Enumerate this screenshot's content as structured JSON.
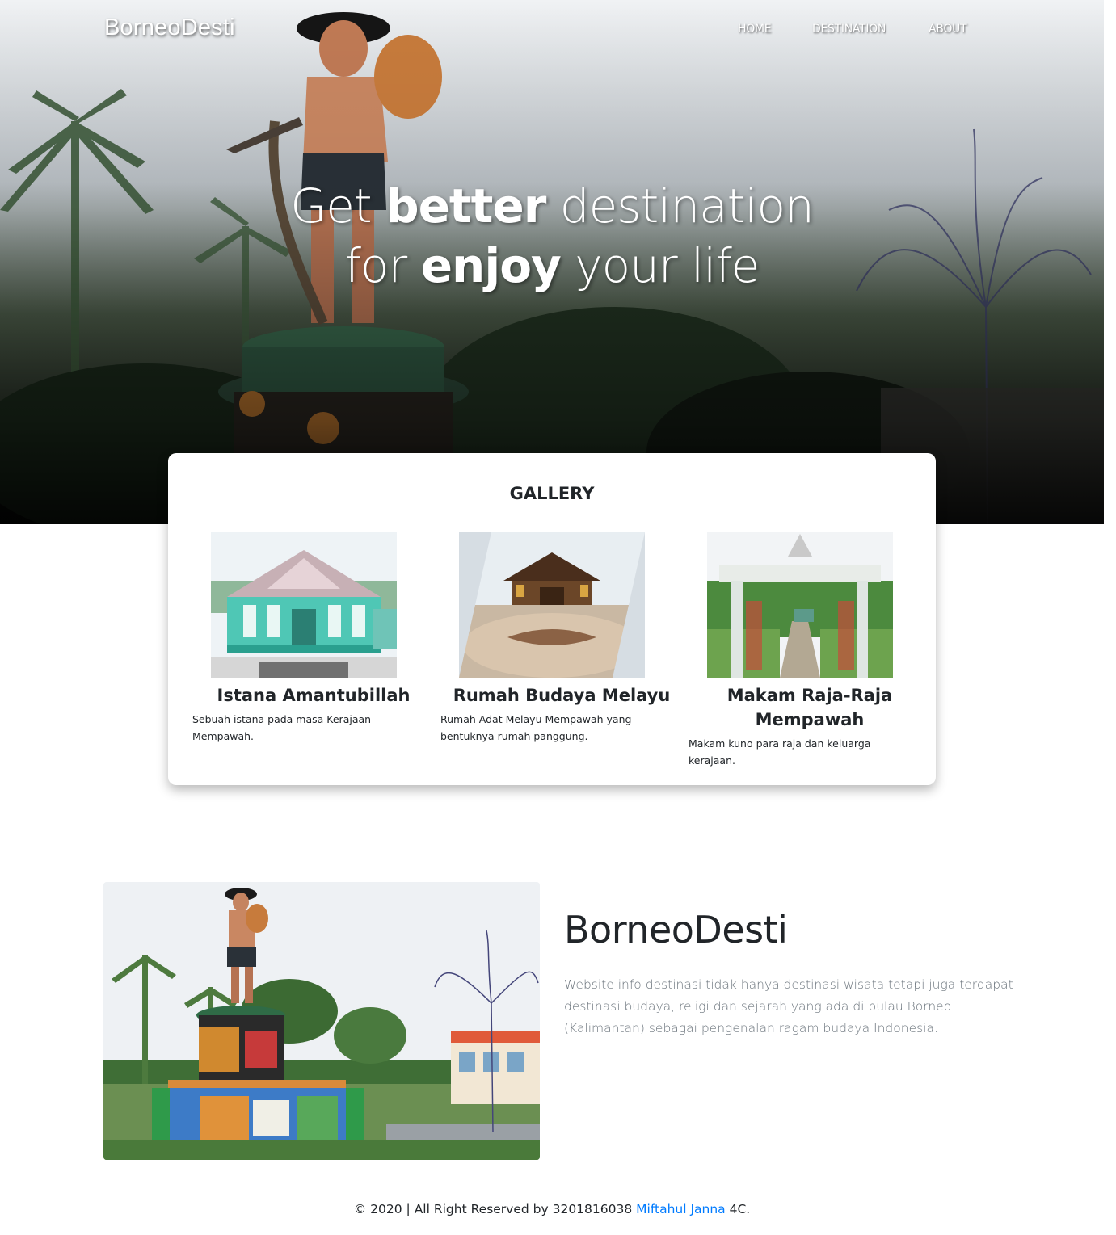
{
  "navbar": {
    "brand": "BorneoDesti",
    "items": [
      {
        "label": "HOME"
      },
      {
        "label": "DESTINATION"
      },
      {
        "label": "ABOUT"
      }
    ]
  },
  "hero": {
    "line1_a": "Get ",
    "line1_b": "better",
    "line1_c": " destination",
    "line2_a": "for ",
    "line2_b": "enjoy",
    "line2_c": " your life"
  },
  "gallery": {
    "title": "GALLERY",
    "items": [
      {
        "name": "Istana Amantubillah",
        "description": "Sebuah istana pada masa Kerajaan Mempawah."
      },
      {
        "name": "Rumah Budaya Melayu",
        "description": "Rumah Adat Melayu Mempawah yang bentuknya rumah panggung."
      },
      {
        "name": "Makam Raja-Raja Mempawah",
        "description": "Makam kuno para raja dan keluarga kerajaan."
      }
    ]
  },
  "about": {
    "title": "BorneoDesti",
    "text": "Website info destinasi tidak hanya destinasi wisata tetapi juga terdapat destinasi budaya, religi dan sejarah yang ada di pulau Borneo (Kalimantan) sebagai pengenalan ragam budaya Indonesia."
  },
  "footer": {
    "prefix": "© 2020 | All Right Reserved by 3201816038 ",
    "author": "Miftahul Janna",
    "suffix": " 4C."
  }
}
